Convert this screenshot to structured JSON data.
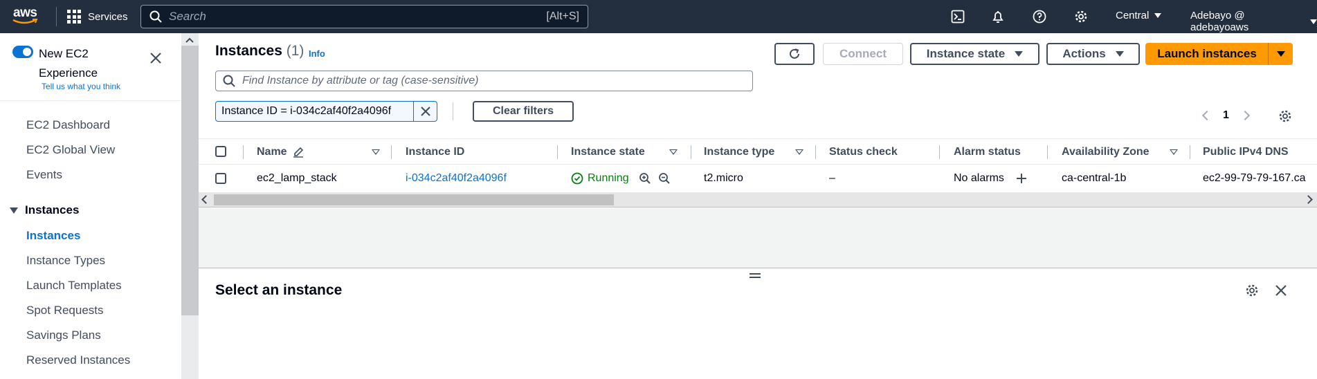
{
  "topnav": {
    "logo_text": "aws",
    "services_label": "Services",
    "search_placeholder": "Search",
    "search_shortcut": "[Alt+S]",
    "region": "Central",
    "account": "Adebayo @ adebayoaws",
    "icons": [
      "cloudshell-icon",
      "notifications-bell-icon",
      "help-icon",
      "settings-gear-icon"
    ]
  },
  "sidebar": {
    "experience_title": "New EC2 Experience",
    "tell_us": "Tell us what you think",
    "links": [
      "EC2 Dashboard",
      "EC2 Global View",
      "Events"
    ],
    "group": "Instances",
    "group_items": [
      "Instances",
      "Instance Types",
      "Launch Templates",
      "Spot Requests",
      "Savings Plans",
      "Reserved Instances"
    ],
    "active_item": "Instances"
  },
  "main": {
    "title": "Instances",
    "count": "(1)",
    "info": "Info",
    "buttons": {
      "connect": "Connect",
      "instance_state": "Instance state",
      "actions": "Actions",
      "launch": "Launch instances",
      "clear_filters": "Clear filters"
    },
    "find_placeholder": "Find Instance by attribute or tag (case-sensitive)",
    "filter_token": "Instance ID = i-034c2af40f2a4096f",
    "page": "1",
    "columns": [
      "Name",
      "Instance ID",
      "Instance state",
      "Instance type",
      "Status check",
      "Alarm status",
      "Availability Zone",
      "Public IPv4 DNS"
    ],
    "row": {
      "name": "ec2_lamp_stack",
      "instance_id": "i-034c2af40f2a4096f",
      "state": "Running",
      "type": "t2.micro",
      "status_check": "–",
      "alarm_status": "No alarms",
      "az": "ca-central-1b",
      "public_dns": "ec2-99-79-79-167.ca"
    }
  },
  "split_panel": {
    "title": "Select an instance"
  },
  "colors": {
    "nav_bg": "#232f3e",
    "link": "#0972d3",
    "primary": "#ff9900",
    "success": "#037f0c"
  }
}
